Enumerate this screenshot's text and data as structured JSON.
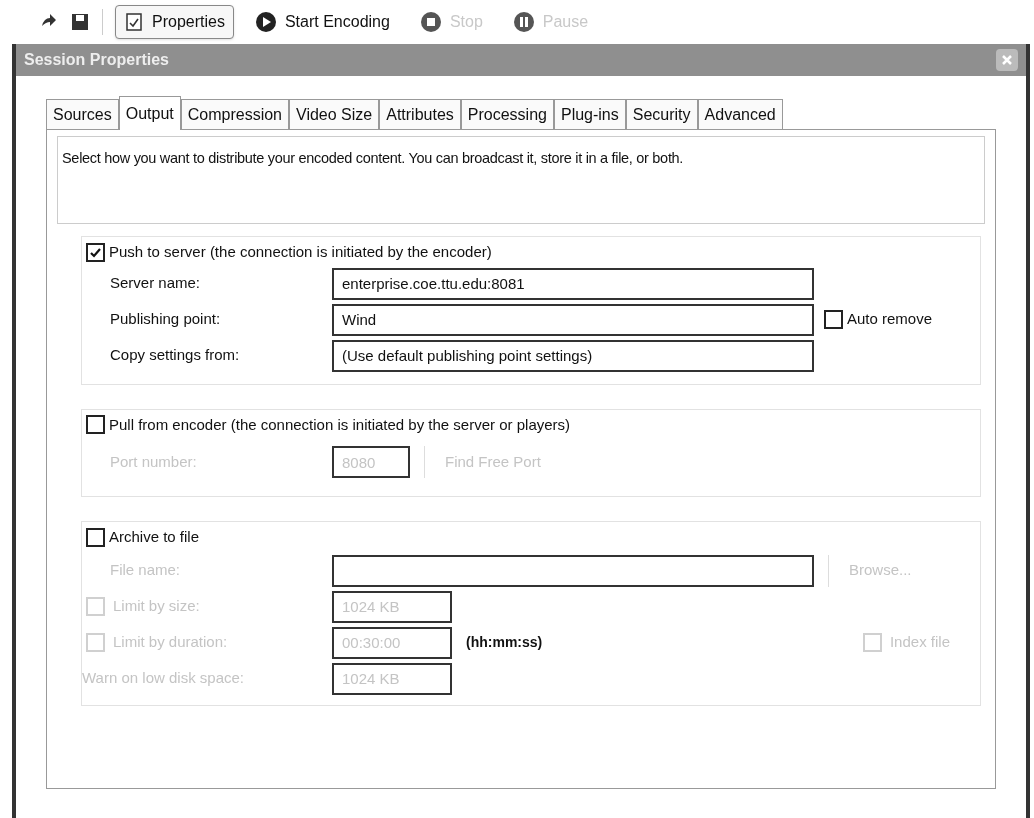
{
  "toolbar": {
    "items": [
      {
        "kind": "toggle",
        "label": "Properties",
        "selected": true,
        "disabled": false
      },
      {
        "kind": "start",
        "label": "Start Encoding",
        "selected": false,
        "disabled": false
      },
      {
        "kind": "stop",
        "label": "Stop",
        "selected": false,
        "disabled": true
      },
      {
        "kind": "pause",
        "label": "Pause",
        "selected": false,
        "disabled": true
      }
    ]
  },
  "dialog": {
    "title": "Session Properties",
    "tabs": [
      {
        "label": "Sources",
        "selected": false
      },
      {
        "label": "Output",
        "selected": true
      },
      {
        "label": "Compression",
        "selected": false
      },
      {
        "label": "Video Size",
        "selected": false
      },
      {
        "label": "Attributes",
        "selected": false
      },
      {
        "label": "Processing",
        "selected": false
      },
      {
        "label": "Plug-ins",
        "selected": false
      },
      {
        "label": "Security",
        "selected": false
      },
      {
        "label": "Advanced",
        "selected": false
      }
    ],
    "description": "Select how you want to distribute your encoded content. You can broadcast it, store it in a file, or both.",
    "push": {
      "label": "Push to server (the connection is initiated by the encoder)",
      "checked": true,
      "fields": [
        {
          "label": "Server name:",
          "value": "enterprise.coe.ttu.edu:8081"
        },
        {
          "label": "Publishing point:",
          "value": "Wind"
        },
        {
          "label": "Copy settings from:",
          "value": "(Use default publishing point settings)"
        }
      ],
      "auto_remove": {
        "label": "Auto remove",
        "checked": false
      }
    },
    "pull": {
      "label": "Pull from encoder (the connection is initiated by the server or players)",
      "checked": false,
      "port": {
        "label": "Port number:",
        "value": "8080",
        "disabled": true
      },
      "find_button": {
        "label": "Find Free Port",
        "disabled": true
      }
    },
    "archive": {
      "label": "Archive to file",
      "checked": false,
      "file_name": {
        "label": "File name:",
        "disabled": true
      },
      "browse_button": {
        "label": "Browse...",
        "disabled": true
      },
      "limit_size": {
        "label": "Limit by size:",
        "checked": false,
        "value": "1024 KB",
        "disabled": true
      },
      "limit_duration": {
        "label": "Limit by duration:",
        "checked": false,
        "value": "00:30:00",
        "format": "(hh:mm:ss)",
        "disabled": true
      },
      "index_file": {
        "label": "Index file",
        "checked": false,
        "disabled": true
      },
      "warn": {
        "label": "Warn on low disk space:",
        "value": "1024 KB",
        "disabled": true
      }
    }
  }
}
